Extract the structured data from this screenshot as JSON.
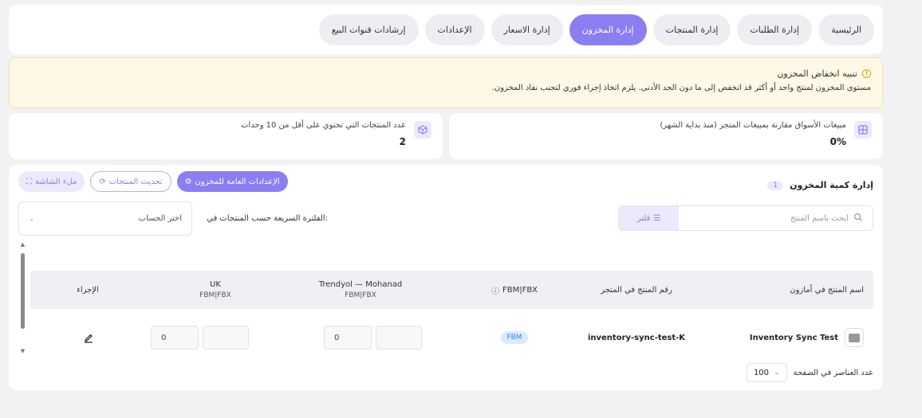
{
  "nav": {
    "tabs": [
      {
        "label": "الرئيسية",
        "active": false
      },
      {
        "label": "إدارة الطلبات",
        "active": false
      },
      {
        "label": "إدارة المنتجات",
        "active": false
      },
      {
        "label": "إدارة المخزون",
        "active": true
      },
      {
        "label": "إدارة الاسعار",
        "active": false
      },
      {
        "label": "الإعدادات",
        "active": false
      },
      {
        "label": "إرشادات قنوات البيع",
        "active": false
      }
    ]
  },
  "alert": {
    "title": "تنبيه انخفاض المخزون",
    "text": "مستوى المخزون لمنتج واحد أو أكثر قد انخفض إلى ما دون الحد الأدنى. يلزم اتخاذ إجراء فوري لتجنب نفاد المخزون."
  },
  "stats": {
    "sales": {
      "label": "مبيعات الأسواق مقارنة بمبيعات المتجر (منذ بداية الشهر)",
      "value": "0%"
    },
    "low_stock": {
      "label": "عدد المنتجات التي تحتوي على أقل من 10 وحدات",
      "value": "2"
    }
  },
  "main": {
    "title": "إدارة كمية المخزون",
    "count": "1",
    "buttons": {
      "fullscreen": "ملء الشاشة",
      "refresh": "تحديث المنتجات",
      "settings": "الإعدادات العامة للمخزون"
    },
    "search_placeholder": "ابحث باسم المنتج",
    "filter_label": "فلتر",
    "quick_filter_label": ":الفلترة السريعة حسب المنتجات في",
    "account_placeholder": "اختر الحساب"
  },
  "table": {
    "headers": {
      "product_name": "اسم المنتج في أمازون",
      "store_sku": "رقم المنتج في المتجر",
      "fbm_fbx": "FBM|FBX",
      "trendyol": "Trendyol — Mohanad",
      "trendyol_sub": "FBM|FBX",
      "uk": "UK",
      "uk_sub": "FBM|FBX",
      "action": "الإجراء"
    },
    "rows": [
      {
        "name": "Inventory Sync Test",
        "sku": "inventory-sync-test-K",
        "fulfillment": "FBM",
        "trendyol_qty": "0",
        "uk_qty": "0"
      }
    ]
  },
  "pager": {
    "label": "عدد العناصر في الصفحة",
    "page_size": "100"
  },
  "colors": {
    "accent": "#8b7ef2",
    "alert_bg": "#fef9e6",
    "badge_blue": "#3b82f6"
  }
}
